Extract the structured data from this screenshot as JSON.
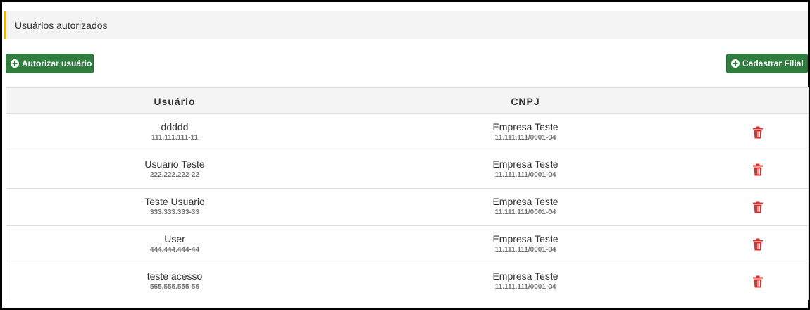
{
  "panel": {
    "title": "Usuários autorizados"
  },
  "actions": {
    "authorize_label": "Autorizar usuário",
    "register_branch_label": "Cadastrar Filial"
  },
  "table": {
    "headers": {
      "user": "Usuário",
      "cnpj": "CNPJ"
    },
    "rows": [
      {
        "name": "ddddd",
        "cpf": "111.111.111-11",
        "company": "Empresa Teste",
        "cnpj": "11.111.111/0001-04"
      },
      {
        "name": "Usuario Teste",
        "cpf": "222.222.222-22",
        "company": "Empresa Teste",
        "cnpj": "11.111.111/0001-04"
      },
      {
        "name": "Teste Usuario",
        "cpf": "333.333.333-33",
        "company": "Empresa Teste",
        "cnpj": "11.111.111/0001-04"
      },
      {
        "name": "User",
        "cpf": "444.444.444-44",
        "company": "Empresa Teste",
        "cnpj": "11.111.111/0001-04"
      },
      {
        "name": "teste acesso",
        "cpf": "555.555.555-55",
        "company": "Empresa Teste",
        "cnpj": "11.111.111/0001-04"
      }
    ]
  },
  "icons": {
    "add": "plus-circle-icon",
    "delete": "trash-icon"
  },
  "colors": {
    "primary_button": "#2f7d3f",
    "heading_accent": "#f0b400",
    "delete_icon": "#d9302c"
  }
}
